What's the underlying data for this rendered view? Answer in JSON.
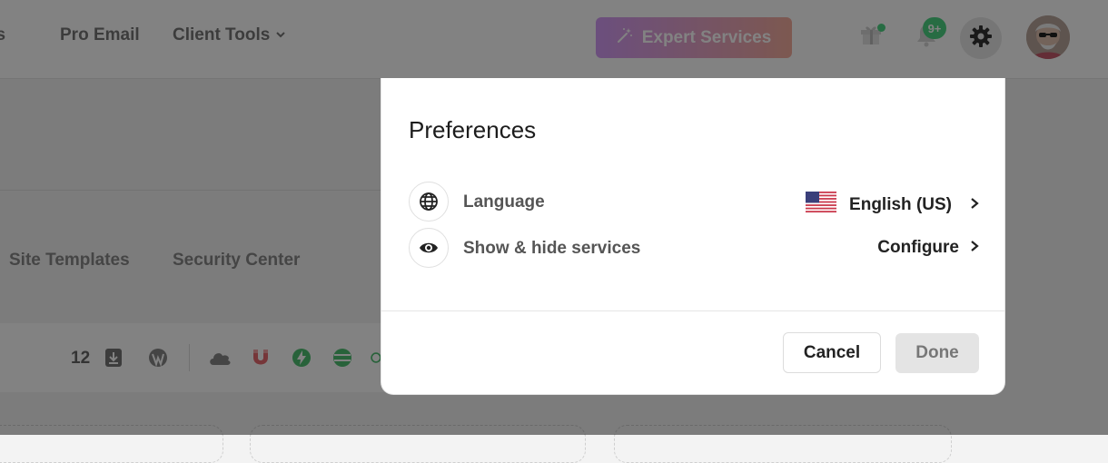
{
  "header": {
    "nav": [
      "ains",
      "Pro Email",
      "Client Tools"
    ],
    "expert_services_label": "Expert Services",
    "notification_badge": "9+"
  },
  "page": {
    "tabs": [
      "Site Templates",
      "Security Center"
    ],
    "toolbar_count": "12"
  },
  "modal": {
    "title": "Preferences",
    "rows": [
      {
        "label": "Language",
        "value": "English (US)",
        "icon": "globe-icon"
      },
      {
        "label": "Show & hide services",
        "value": "Configure",
        "icon": "eye-icon"
      }
    ],
    "cancel_label": "Cancel",
    "done_label": "Done"
  },
  "colors": {
    "overlay": "#00000080",
    "expert_gradient_start": "#d39bf6",
    "expert_gradient_end": "#f5ad9e",
    "badge_green": "#4dd583",
    "done_disabled_bg": "#e4e4e4"
  }
}
